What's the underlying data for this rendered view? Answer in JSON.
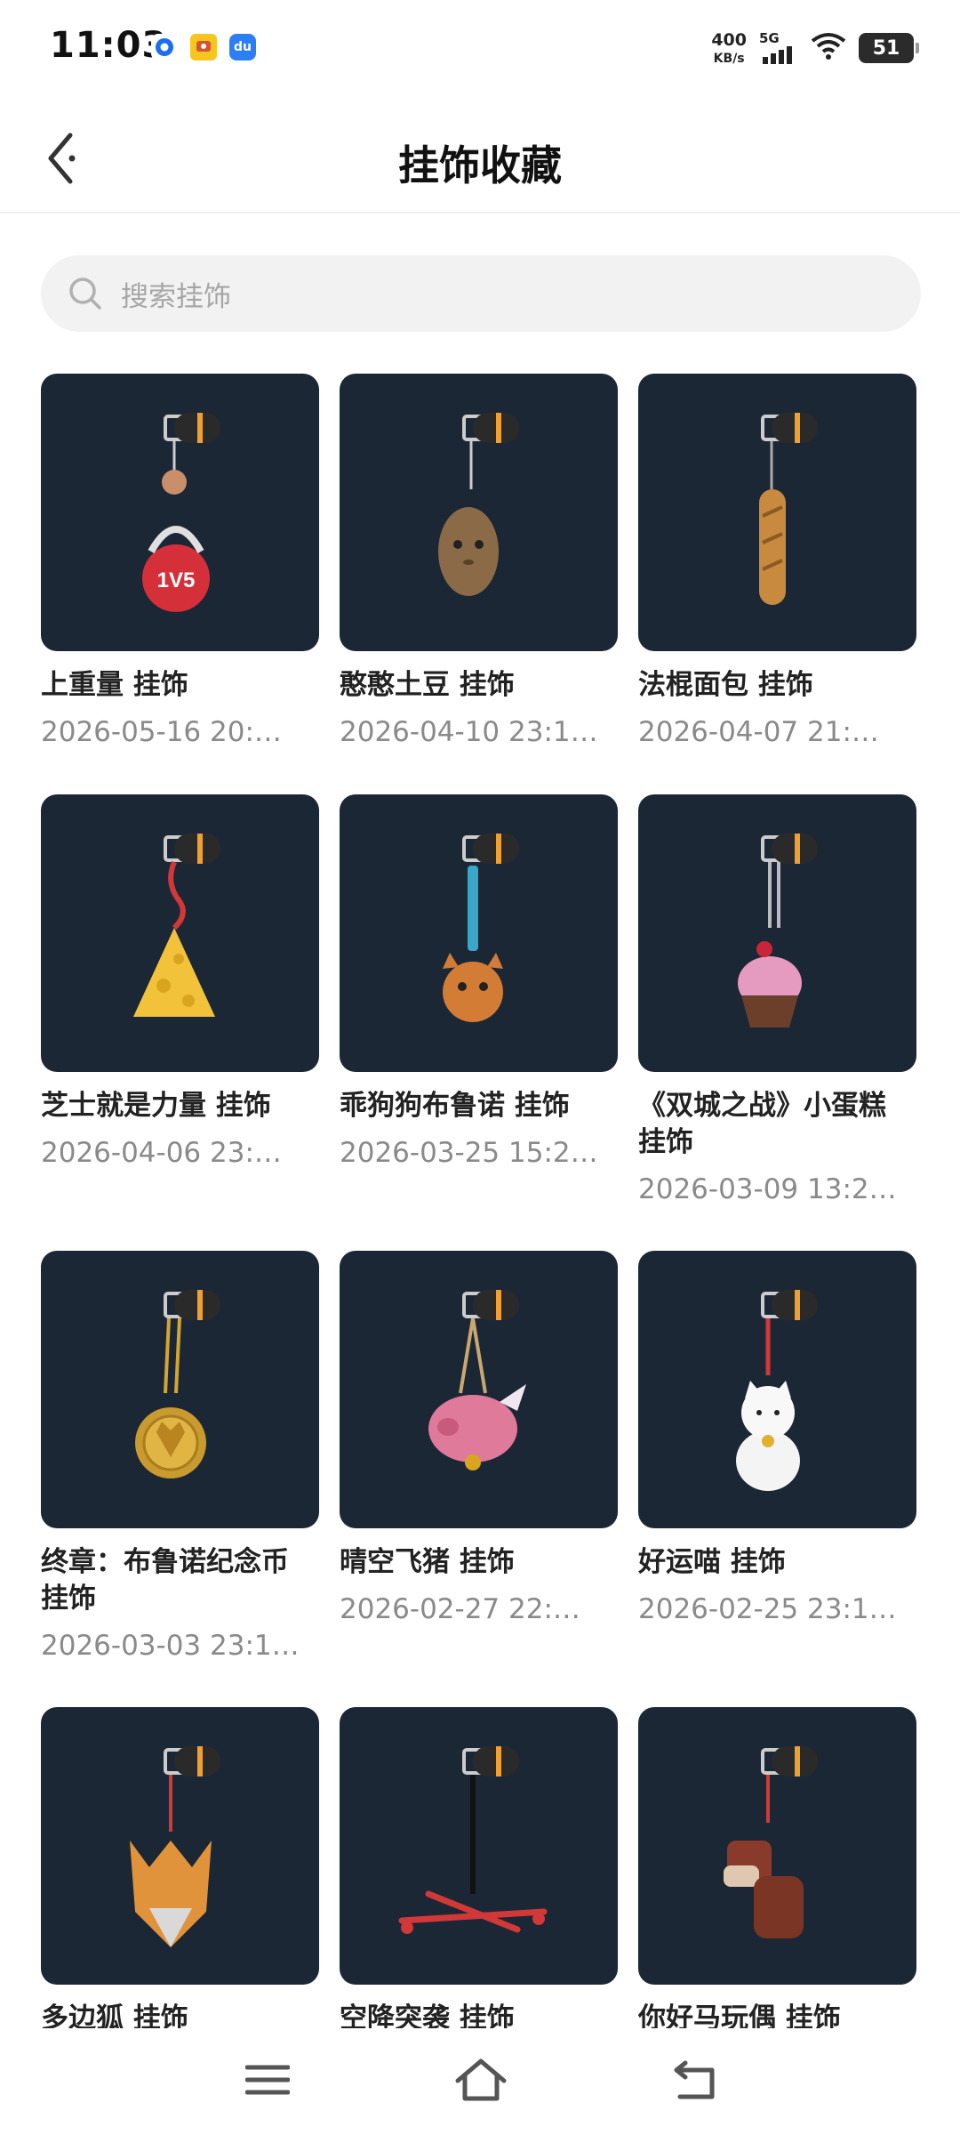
{
  "status_bar": {
    "time": "11:03",
    "net_speed_value": "400",
    "net_speed_unit": "KB/s",
    "network": "5G",
    "battery": "51",
    "app_icons": [
      "app-icon-blue-ring",
      "app-icon-yellow",
      "app-icon-du"
    ]
  },
  "header": {
    "title": "挂饰收藏",
    "back_icon": "chevron-left-icon"
  },
  "search": {
    "placeholder": "搜索挂饰"
  },
  "items": [
    {
      "name": " 上重量 挂饰",
      "date": "2026-05-16 20:…",
      "charm": "kettlebell"
    },
    {
      "name": "憨憨土豆 挂饰",
      "date": "2026-04-10 23:1…",
      "charm": "potato"
    },
    {
      "name": "法棍面包 挂饰",
      "date": "2026-04-07 21:…",
      "charm": "baguette"
    },
    {
      "name": "芝士就是力量 挂饰",
      "date": "2026-04-06 23:…",
      "charm": "cheese"
    },
    {
      "name": "乖狗狗布鲁诺 挂饰",
      "date": "2026-03-25 15:2…",
      "charm": "dog"
    },
    {
      "name": "《双城之战》小蛋糕 挂饰",
      "date": "2026-03-09 13:2…",
      "charm": "cupcake"
    },
    {
      "name": "终章：布鲁诺纪念币 挂饰",
      "date": "2026-03-03 23:1…",
      "charm": "coin"
    },
    {
      "name": "晴空飞猪 挂饰",
      "date": "2026-02-27 22:…",
      "charm": "pig"
    },
    {
      "name": "好运喵 挂饰",
      "date": "2026-02-25 23:1…",
      "charm": "lucky-cat"
    },
    {
      "name": "多边狐 挂饰",
      "date": "",
      "charm": "fox"
    },
    {
      "name": "空降突袭 挂饰",
      "date": "",
      "charm": "drone"
    },
    {
      "name": "你好马玩偶 挂饰",
      "date": "",
      "charm": "horse"
    }
  ],
  "colors": {
    "thumb_bg": "#1c2736",
    "accent_orange": "#f0a030"
  },
  "bottom_nav": [
    "menu-icon",
    "home-icon",
    "back-icon"
  ]
}
